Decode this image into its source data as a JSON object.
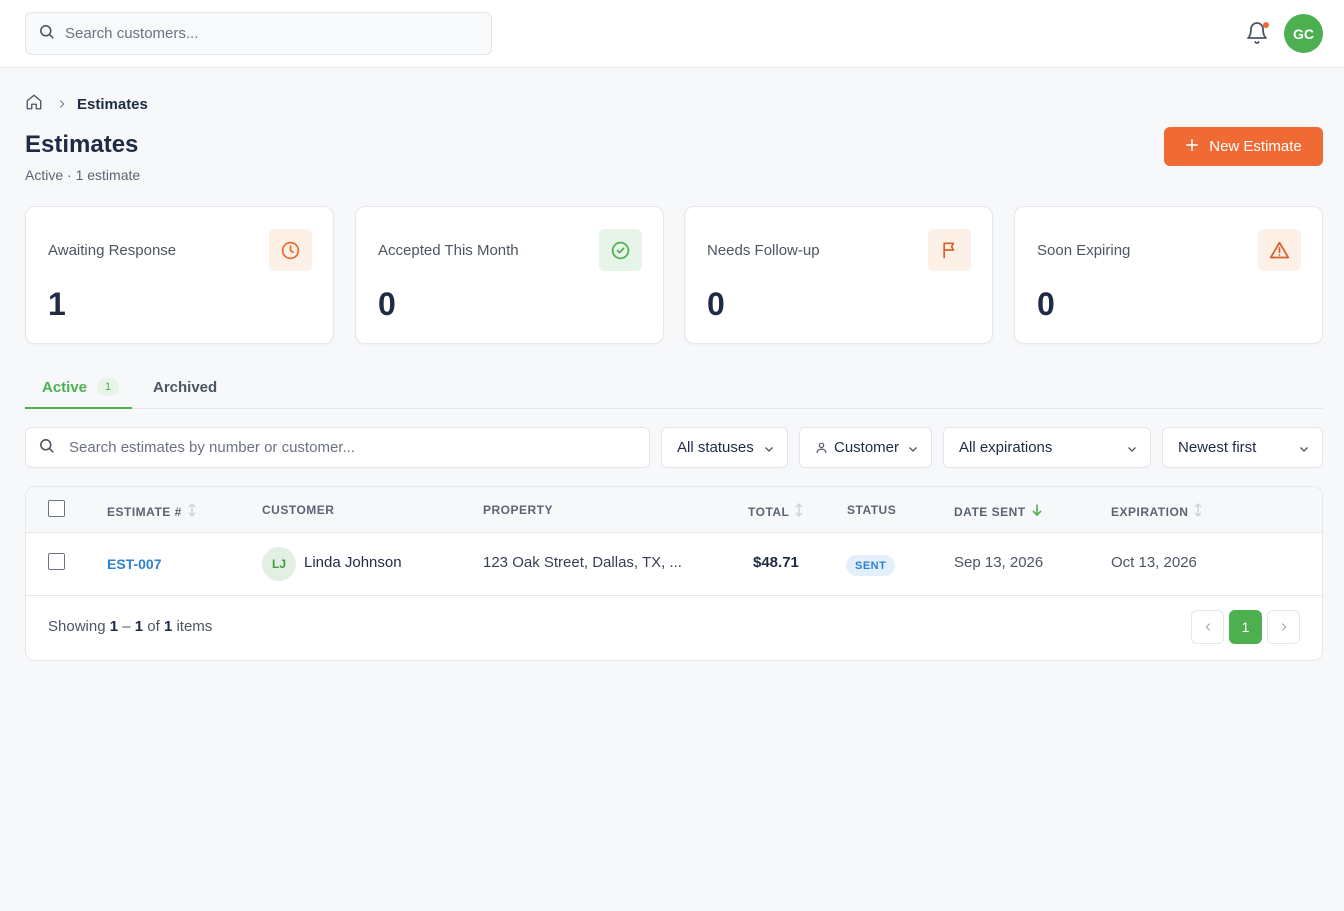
{
  "topbar": {
    "search_placeholder": "Search customers...",
    "avatar_initials": "GC"
  },
  "breadcrumb": {
    "current": "Estimates"
  },
  "page": {
    "title": "Estimates",
    "subtitle": "Active · 1 estimate",
    "new_button": "New Estimate"
  },
  "cards": [
    {
      "label": "Awaiting Response",
      "value": "1",
      "icon": "clock-icon",
      "icon_bg": "#fdf0e6",
      "icon_color": "#ef6a35"
    },
    {
      "label": "Accepted This Month",
      "value": "0",
      "icon": "check-circle-icon",
      "icon_bg": "#e7f4e8",
      "icon_color": "#4caf50"
    },
    {
      "label": "Needs Follow-up",
      "value": "0",
      "icon": "flag-icon",
      "icon_bg": "#fdf0e6",
      "icon_color": "#d9622b"
    },
    {
      "label": "Soon Expiring",
      "value": "0",
      "icon": "warning-icon",
      "icon_bg": "#fdf0e6",
      "icon_color": "#d9622b"
    }
  ],
  "tabs": {
    "active_label": "Active",
    "active_count": "1",
    "archived_label": "Archived"
  },
  "filters": {
    "search_placeholder": "Search estimates by number or customer...",
    "status": "All statuses",
    "customer": "Customer",
    "expiration": "All expirations",
    "sort": "Newest first"
  },
  "table": {
    "headers": {
      "estimate": "ESTIMATE #",
      "customer": "CUSTOMER",
      "property": "PROPERTY",
      "total": "TOTAL",
      "status": "STATUS",
      "date_sent": "DATE SENT",
      "expiration": "EXPIRATION"
    },
    "rows": [
      {
        "estimate": "EST-007",
        "initials": "LJ",
        "customer": "Linda Johnson",
        "property": "123 Oak Street, Dallas, TX, ...",
        "total": "$48.71",
        "status": "SENT",
        "date_sent": "Sep 13, 2026",
        "expiration": "Oct 13, 2026"
      }
    ]
  },
  "footer": {
    "showing": "Showing",
    "range_start": "1",
    "dash": "–",
    "range_end": "1",
    "of": "of",
    "total": "1",
    "items": "items",
    "current_page": "1"
  },
  "colors": {
    "accent_orange": "#ef6a35",
    "accent_green": "#4caf50",
    "link_blue": "#2f80d1"
  }
}
